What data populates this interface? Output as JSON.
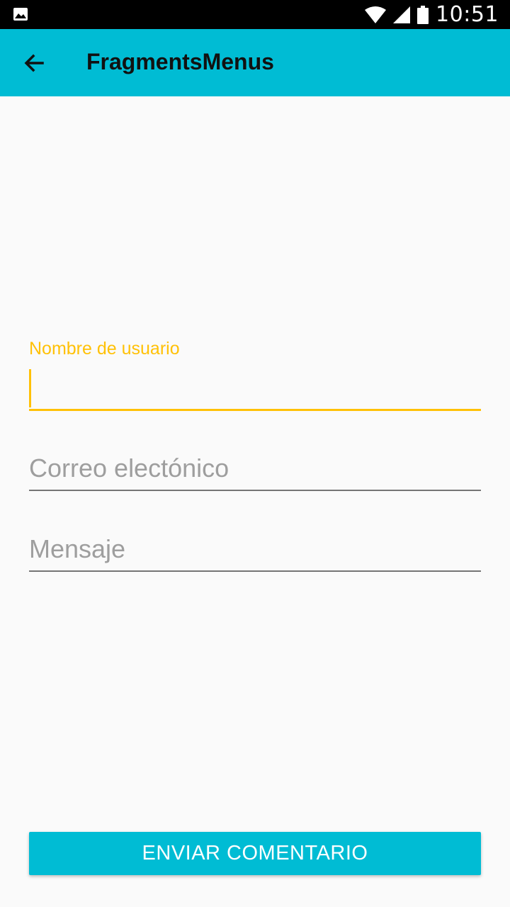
{
  "status_bar": {
    "time": "10:51",
    "icons": [
      "image-notification-icon",
      "wifi-icon",
      "cell-signal-icon",
      "battery-icon"
    ]
  },
  "app_bar": {
    "title": "FragmentsMenus",
    "back_icon": "arrow-back-icon",
    "color": "#00bcd4"
  },
  "form": {
    "username": {
      "label": "Nombre de usuario",
      "value": "",
      "focused": true
    },
    "email": {
      "placeholder": "Correo electónico",
      "value": ""
    },
    "message": {
      "placeholder": "Mensaje",
      "value": ""
    },
    "accent_color": "#ffc107"
  },
  "submit": {
    "label": "ENVIAR COMENTARIO"
  }
}
